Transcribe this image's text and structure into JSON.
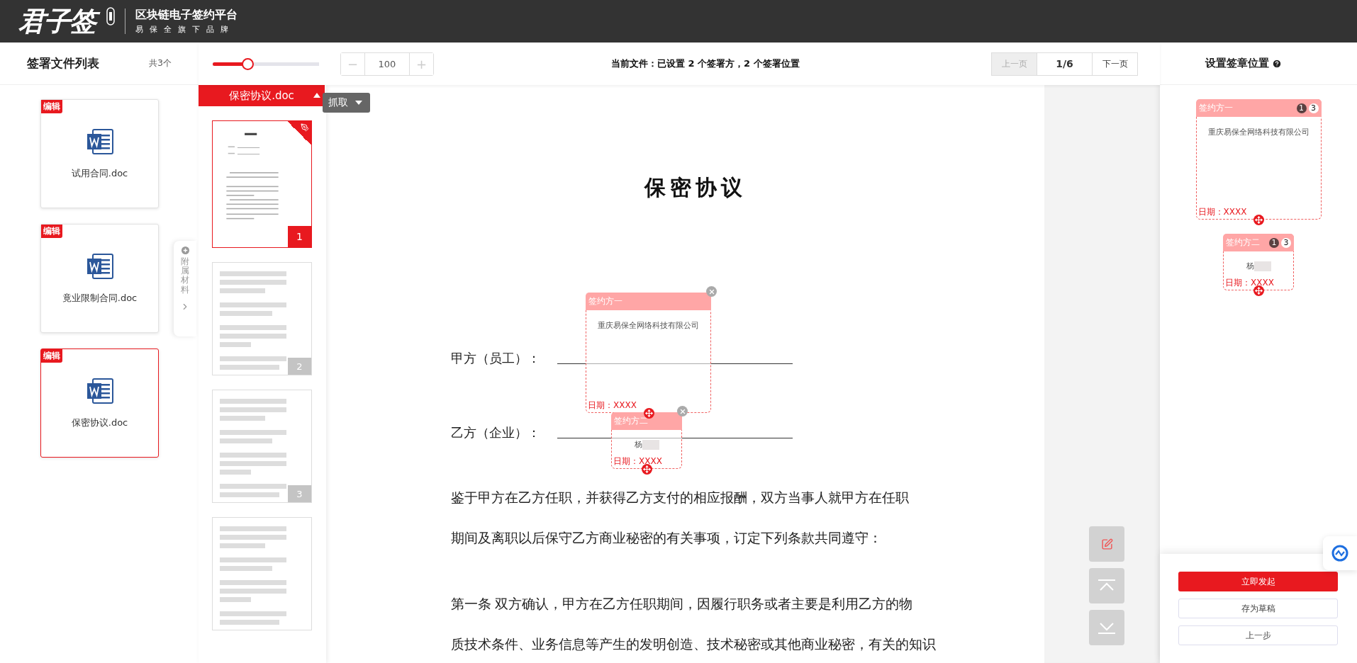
{
  "header": {
    "logo": "君子签",
    "platform": "区块链电子签约平台",
    "brand": "易保全旗下品牌"
  },
  "file_list": {
    "title": "签署文件列表",
    "count": "共3个",
    "files": [
      {
        "name": "试用合同.doc",
        "badge": "编辑",
        "selected": false
      },
      {
        "name": "竟业限制合同.doc",
        "badge": "编辑",
        "selected": false
      },
      {
        "name": "保密协议.doc",
        "badge": "编辑",
        "selected": true
      }
    ]
  },
  "attachment_tab": {
    "label": "附属材料"
  },
  "toolbar": {
    "zoom_slider": {
      "level": 0.33
    },
    "zoom_minus": "−",
    "zoom_value": "100",
    "zoom_plus": "+",
    "status": "当前文件：已设置 2 个签署方，2 个签署位置",
    "prev": {
      "label": "上一页",
      "disabled": true
    },
    "page": "1/6",
    "next": {
      "label": "下一页",
      "disabled": false
    }
  },
  "thumbnails": {
    "file": "保密协议.doc",
    "grab": "抓取",
    "pages": [
      {
        "number": "1",
        "selected": true,
        "signed": true
      },
      {
        "number": "2",
        "selected": false,
        "signed": false
      },
      {
        "number": "3",
        "selected": false,
        "signed": false
      },
      {
        "selected": false,
        "signed": false
      }
    ]
  },
  "document": {
    "title": "保密协议",
    "parties": [
      "甲方（员工）：",
      "乙方（企业）："
    ],
    "paragraphs": [
      [
        "鉴于甲方在乙方任职，并获得乙方支付的相应报酬，双方当事人就甲方在任职",
        "期间及离职以后保守乙方商业秘密的有关事项，订定下列条款共同遵守："
      ],
      [
        "第一条  双方确认，甲方在乙方任职期间，因履行职务或者主要是利用乙方的物",
        "质技术条件、业务信息等产生的发明创造、技术秘密或其他商业秘密，有关的知识"
      ]
    ]
  },
  "placements": [
    {
      "party": "签约方一",
      "content": "重庆易保全网络科技有限公司",
      "redacted": false,
      "date": "日期：XXXX",
      "kind": "large"
    },
    {
      "party": "签约方二",
      "content": "杨",
      "redacted": true,
      "date": "日期：XXXX",
      "kind": "small"
    }
  ],
  "signing_panel": {
    "title": "设置签章位置",
    "parties": [
      {
        "party": "签约方一",
        "content": "重庆易保全网络科技有限公司",
        "redacted": false,
        "date": "日期：XXXX",
        "kind": "large",
        "badges": [
          {
            "text": "1",
            "kind": "dark"
          },
          {
            "text": "3",
            "kind": "light"
          }
        ]
      },
      {
        "party": "签约方二",
        "content": "杨",
        "redacted": true,
        "date": "日期：XXXX",
        "kind": "small",
        "badges": [
          {
            "text": "1",
            "kind": "dark"
          },
          {
            "text": "3",
            "kind": "light"
          }
        ]
      }
    ],
    "actions": [
      {
        "label": "立即发起",
        "kind": "primary"
      },
      {
        "label": "存为草稿",
        "kind": "secondary"
      },
      {
        "label": "上一步",
        "kind": "secondary"
      }
    ]
  }
}
